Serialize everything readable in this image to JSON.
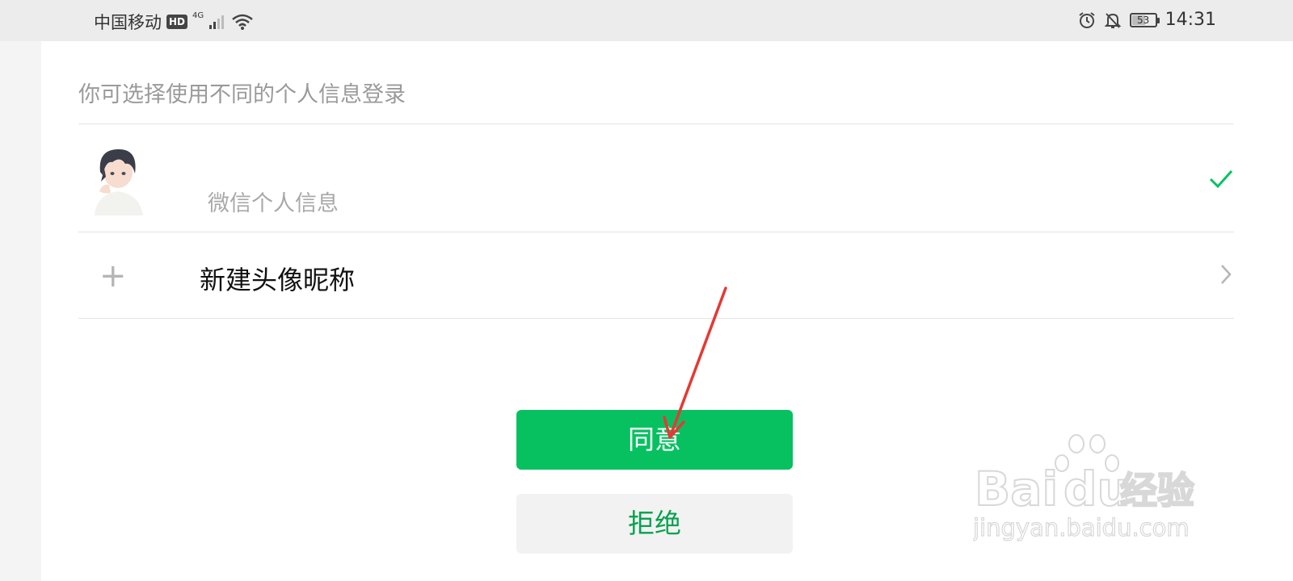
{
  "status_bar": {
    "carrier": "中国移动",
    "hd_badge": "HD",
    "network_type": "4G",
    "battery_level": "53",
    "time": "14:31",
    "icons": [
      "signal-icon",
      "wifi-icon",
      "alarm-icon",
      "mute-icon",
      "battery-icon"
    ]
  },
  "login_options": {
    "title": "你可选择使用不同的个人信息登录",
    "options": [
      {
        "label": "微信个人信息",
        "selected": true,
        "icon": "avatar-image"
      },
      {
        "label": "新建头像昵称",
        "icon": "plus-icon"
      }
    ]
  },
  "buttons": {
    "agree_label": "同意",
    "refuse_label": "拒绝"
  },
  "watermark": {
    "brand": "Bai",
    "brand_suffix": "经验",
    "url": "jingyan.baidu.com"
  },
  "colors": {
    "accent": "#07c160",
    "refuse_text": "#07a14f",
    "annotation_arrow": "#e53935"
  }
}
